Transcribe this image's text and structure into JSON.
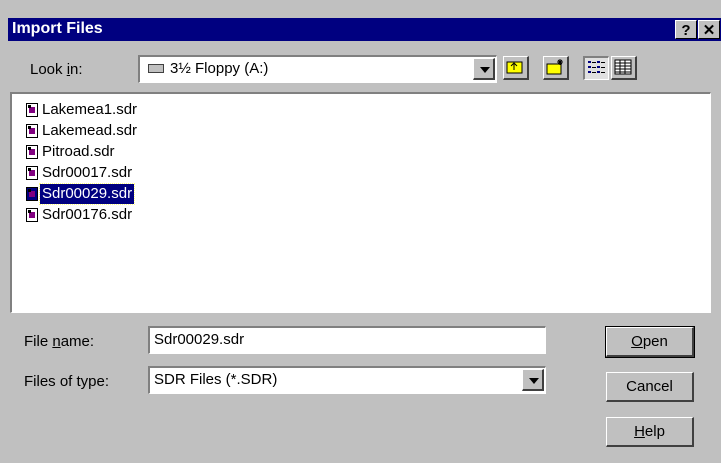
{
  "window": {
    "title": "Import Files",
    "help_btn": "?",
    "close_btn": "✕"
  },
  "look_in": {
    "label_pre": "Look ",
    "label_u": "i",
    "label_post": "n:",
    "value": "3½ Floppy (A:)"
  },
  "files": [
    "Lakemea1.sdr",
    "Lakemead.sdr",
    "Pitroad.sdr",
    "Sdr00017.sdr",
    "Sdr00029.sdr",
    "Sdr00176.sdr"
  ],
  "selected_file": "Sdr00029.sdr",
  "file_name": {
    "label_pre": "File ",
    "label_u": "n",
    "label_post": "ame:",
    "value": "Sdr00029.sdr"
  },
  "file_type": {
    "label": "Files of type:",
    "value": "SDR Files (*.SDR)"
  },
  "buttons": {
    "open_u": "O",
    "open_rest": "pen",
    "cancel": "Cancel",
    "help_u": "H",
    "help_rest": "elp"
  },
  "colors": {
    "titlebar": "#000080",
    "dialog": "#c0c0c0",
    "selection": "#000080"
  }
}
